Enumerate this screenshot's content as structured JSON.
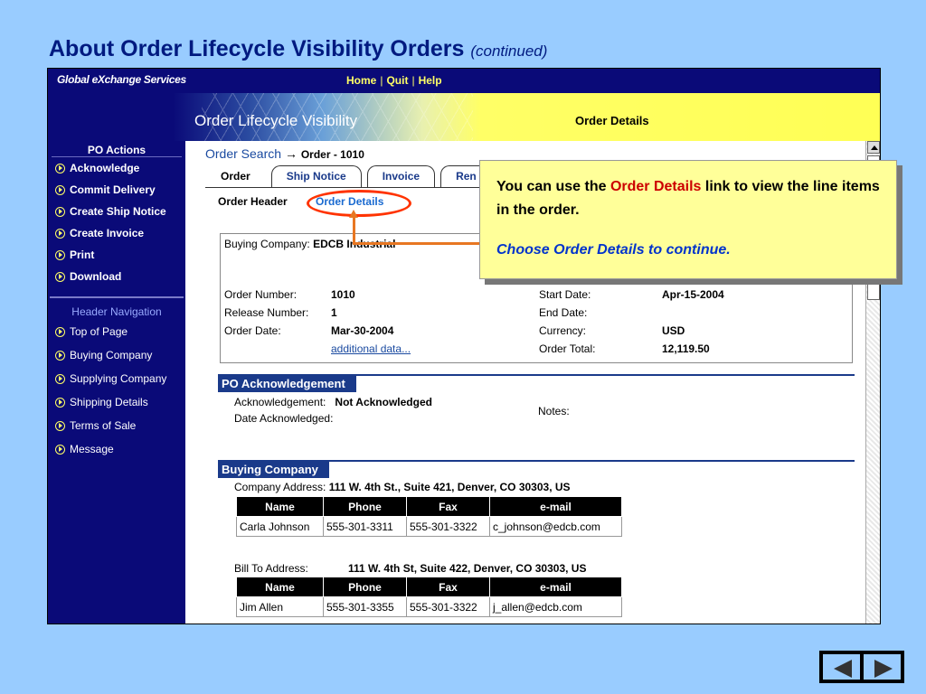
{
  "slide": {
    "title": "About Order Lifecycle Visibility Orders",
    "title_suffix": "(continued)"
  },
  "header": {
    "brand": "Global eXchange Services",
    "nav": [
      "Home",
      "Quit",
      "Help"
    ],
    "app_title": "Order Lifecycle Visibility",
    "section_title": "Order Details"
  },
  "sidebar": {
    "po_actions_title": "PO Actions",
    "po_actions": [
      "Acknowledge",
      "Commit Delivery",
      "Create Ship Notice",
      "Create Invoice",
      "Print",
      "Download"
    ],
    "header_nav_title": "Header Navigation",
    "header_nav": [
      "Top of Page",
      "Buying Company",
      "Supplying Company",
      "Shipping Details",
      "Terms of Sale",
      "Message"
    ]
  },
  "main": {
    "breadcrumb_link": "Order Search",
    "breadcrumb_arrow": "→",
    "breadcrumb_current": "Order - 1010",
    "tabs": [
      "Order",
      "Ship Notice",
      "Invoice",
      "Ren"
    ],
    "subtabs": [
      "Order Header",
      "Order Details"
    ],
    "order": {
      "buying_company_label": "Buying Company:",
      "buying_company": "EDCB Industrial",
      "order_number_label": "Order Number:",
      "order_number": "1010",
      "release_number_label": "Release Number:",
      "release_number": "1",
      "order_date_label": "Order Date:",
      "order_date": "Mar-30-2004",
      "additional_data": "additional data...",
      "start_date_label": "Start Date:",
      "start_date": "Apr-15-2004",
      "end_date_label": "End Date:",
      "end_date": "",
      "currency_label": "Currency:",
      "currency": "USD",
      "order_total_label": "Order Total:",
      "order_total": "12,119.50"
    },
    "ack": {
      "title": "PO Acknowledgement",
      "ack_label": "Acknowledgement:",
      "ack_value": "Not Acknowledged",
      "date_label": "Date Acknowledged:",
      "notes_label": "Notes:"
    },
    "buying": {
      "title": "Buying Company",
      "company_address_label": "Company Address:",
      "company_address": "111 W. 4th St., Suite 421, Denver, CO 30303, US",
      "columns": [
        "Name",
        "Phone",
        "Fax",
        "e-mail"
      ],
      "company_contact": [
        "Carla Johnson",
        "555-301-3311",
        "555-301-3322",
        "c_johnson@edcb.com"
      ],
      "bill_to_label": "Bill To Address:",
      "bill_to": "111 W. 4th St, Suite 422, Denver, CO 30303, US",
      "bill_contact": [
        "Jim Allen",
        "555-301-3355",
        "555-301-3322",
        "j_allen@edcb.com"
      ]
    }
  },
  "callout": {
    "text_before": "You can use the ",
    "highlight": "Order Details",
    "text_after": " link to view the line items in the order.",
    "instruction": "Choose Order Details to continue."
  },
  "colors": {
    "slide_bg": "#99ccff",
    "title": "#001a80",
    "nav_bg": "#0a0a78",
    "accent_yellow": "#ffff66",
    "highlight_red": "#ff3300",
    "connector": "#e87722"
  }
}
